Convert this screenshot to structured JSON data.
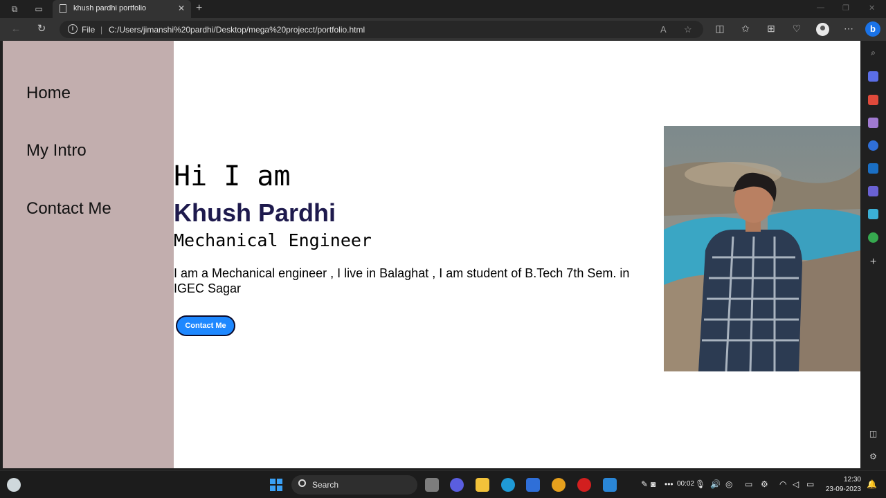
{
  "browser": {
    "tab_title": "khush pardhi portfolio",
    "file_label": "File",
    "separator": "|",
    "url": "C:/Users/jimanshi%20pardhi/Desktop/mega%20projecct/portfolio.html"
  },
  "sidebar": {
    "items": [
      {
        "label": "Home"
      },
      {
        "label": "My Intro"
      },
      {
        "label": "Contact Me"
      }
    ]
  },
  "hero": {
    "greeting": "Hi I am",
    "name": "Khush Pardhi",
    "role": "Mechanical Engineer",
    "description": "I am a Mechanical engineer , I live in Balaghat , I am student of B.Tech 7th Sem. in IGEC Sagar",
    "button_label": "Contact Me"
  },
  "taskbar": {
    "search_label": "Search",
    "time": "12:30",
    "date": "23-09-2023",
    "timer": "00:02"
  },
  "colors": {
    "sidebar_bg": "#c2aeae",
    "name_color": "#1e1a4d",
    "button_bg": "#1e88ff"
  }
}
